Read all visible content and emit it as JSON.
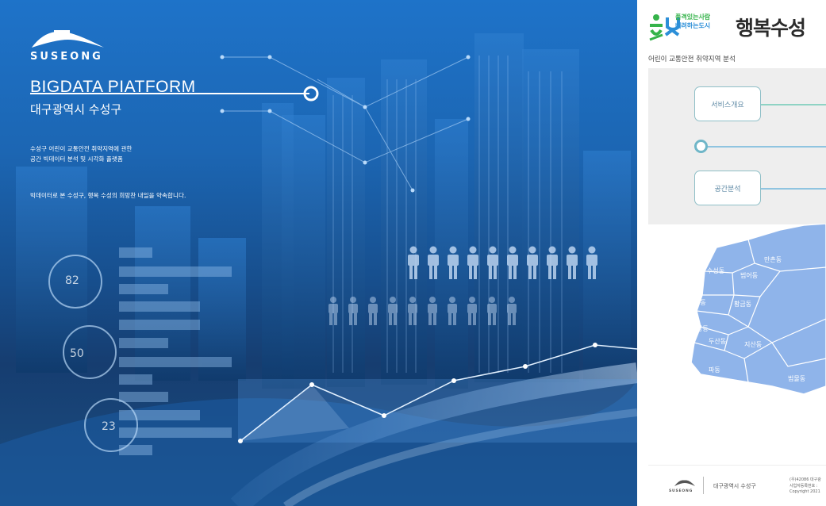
{
  "hero": {
    "logo_text": "SUSEONG",
    "platform_title": "BIGDATA PIATFORM",
    "district": "대구광역시 수성구",
    "desc_line1": "수성구 어린이 교통안전 취약지역에 관한",
    "desc_line2": "공간 빅데이터 분석 및 시각화 플랫폼",
    "desc_line3": "빅데이터로 본 수성구, 행복 수성의 희망찬 내일을 약속합니다.",
    "gauges": [
      {
        "value": "82"
      },
      {
        "value": "50"
      },
      {
        "value": "23"
      }
    ]
  },
  "side": {
    "slogan_line1": "품격있는사람",
    "slogan_line2": "배려하는도시",
    "brand_name": "행복수성",
    "subtitle": "어린이 교통안전 취약지역 분석",
    "menu": {
      "service_overview": "서비스개요",
      "spatial_analysis": "공간분석"
    },
    "map_labels": {
      "manchon": "만촌동",
      "suseong": "수성동",
      "beomeo": "범어동",
      "jung": "중동",
      "hwanggeum": "황금동",
      "sang": "상동",
      "dusan": "두산동",
      "jisan": "지산동",
      "pa": "파동",
      "beommul": "범물동"
    },
    "footer": {
      "logo_text": "SUSEONG",
      "org": "대구광역시 수성구",
      "info_line1": "(우)42086 대구광",
      "info_line2": "사업자등록번호 :",
      "info_line3": "Copyright 2021"
    }
  },
  "colors": {
    "hero_blue": "#1e73c9",
    "brand_green": "#35b34a",
    "brand_blue": "#2c8fd8",
    "menu_border": "#8fbfc7",
    "map_fill": "#8fb4ea"
  }
}
